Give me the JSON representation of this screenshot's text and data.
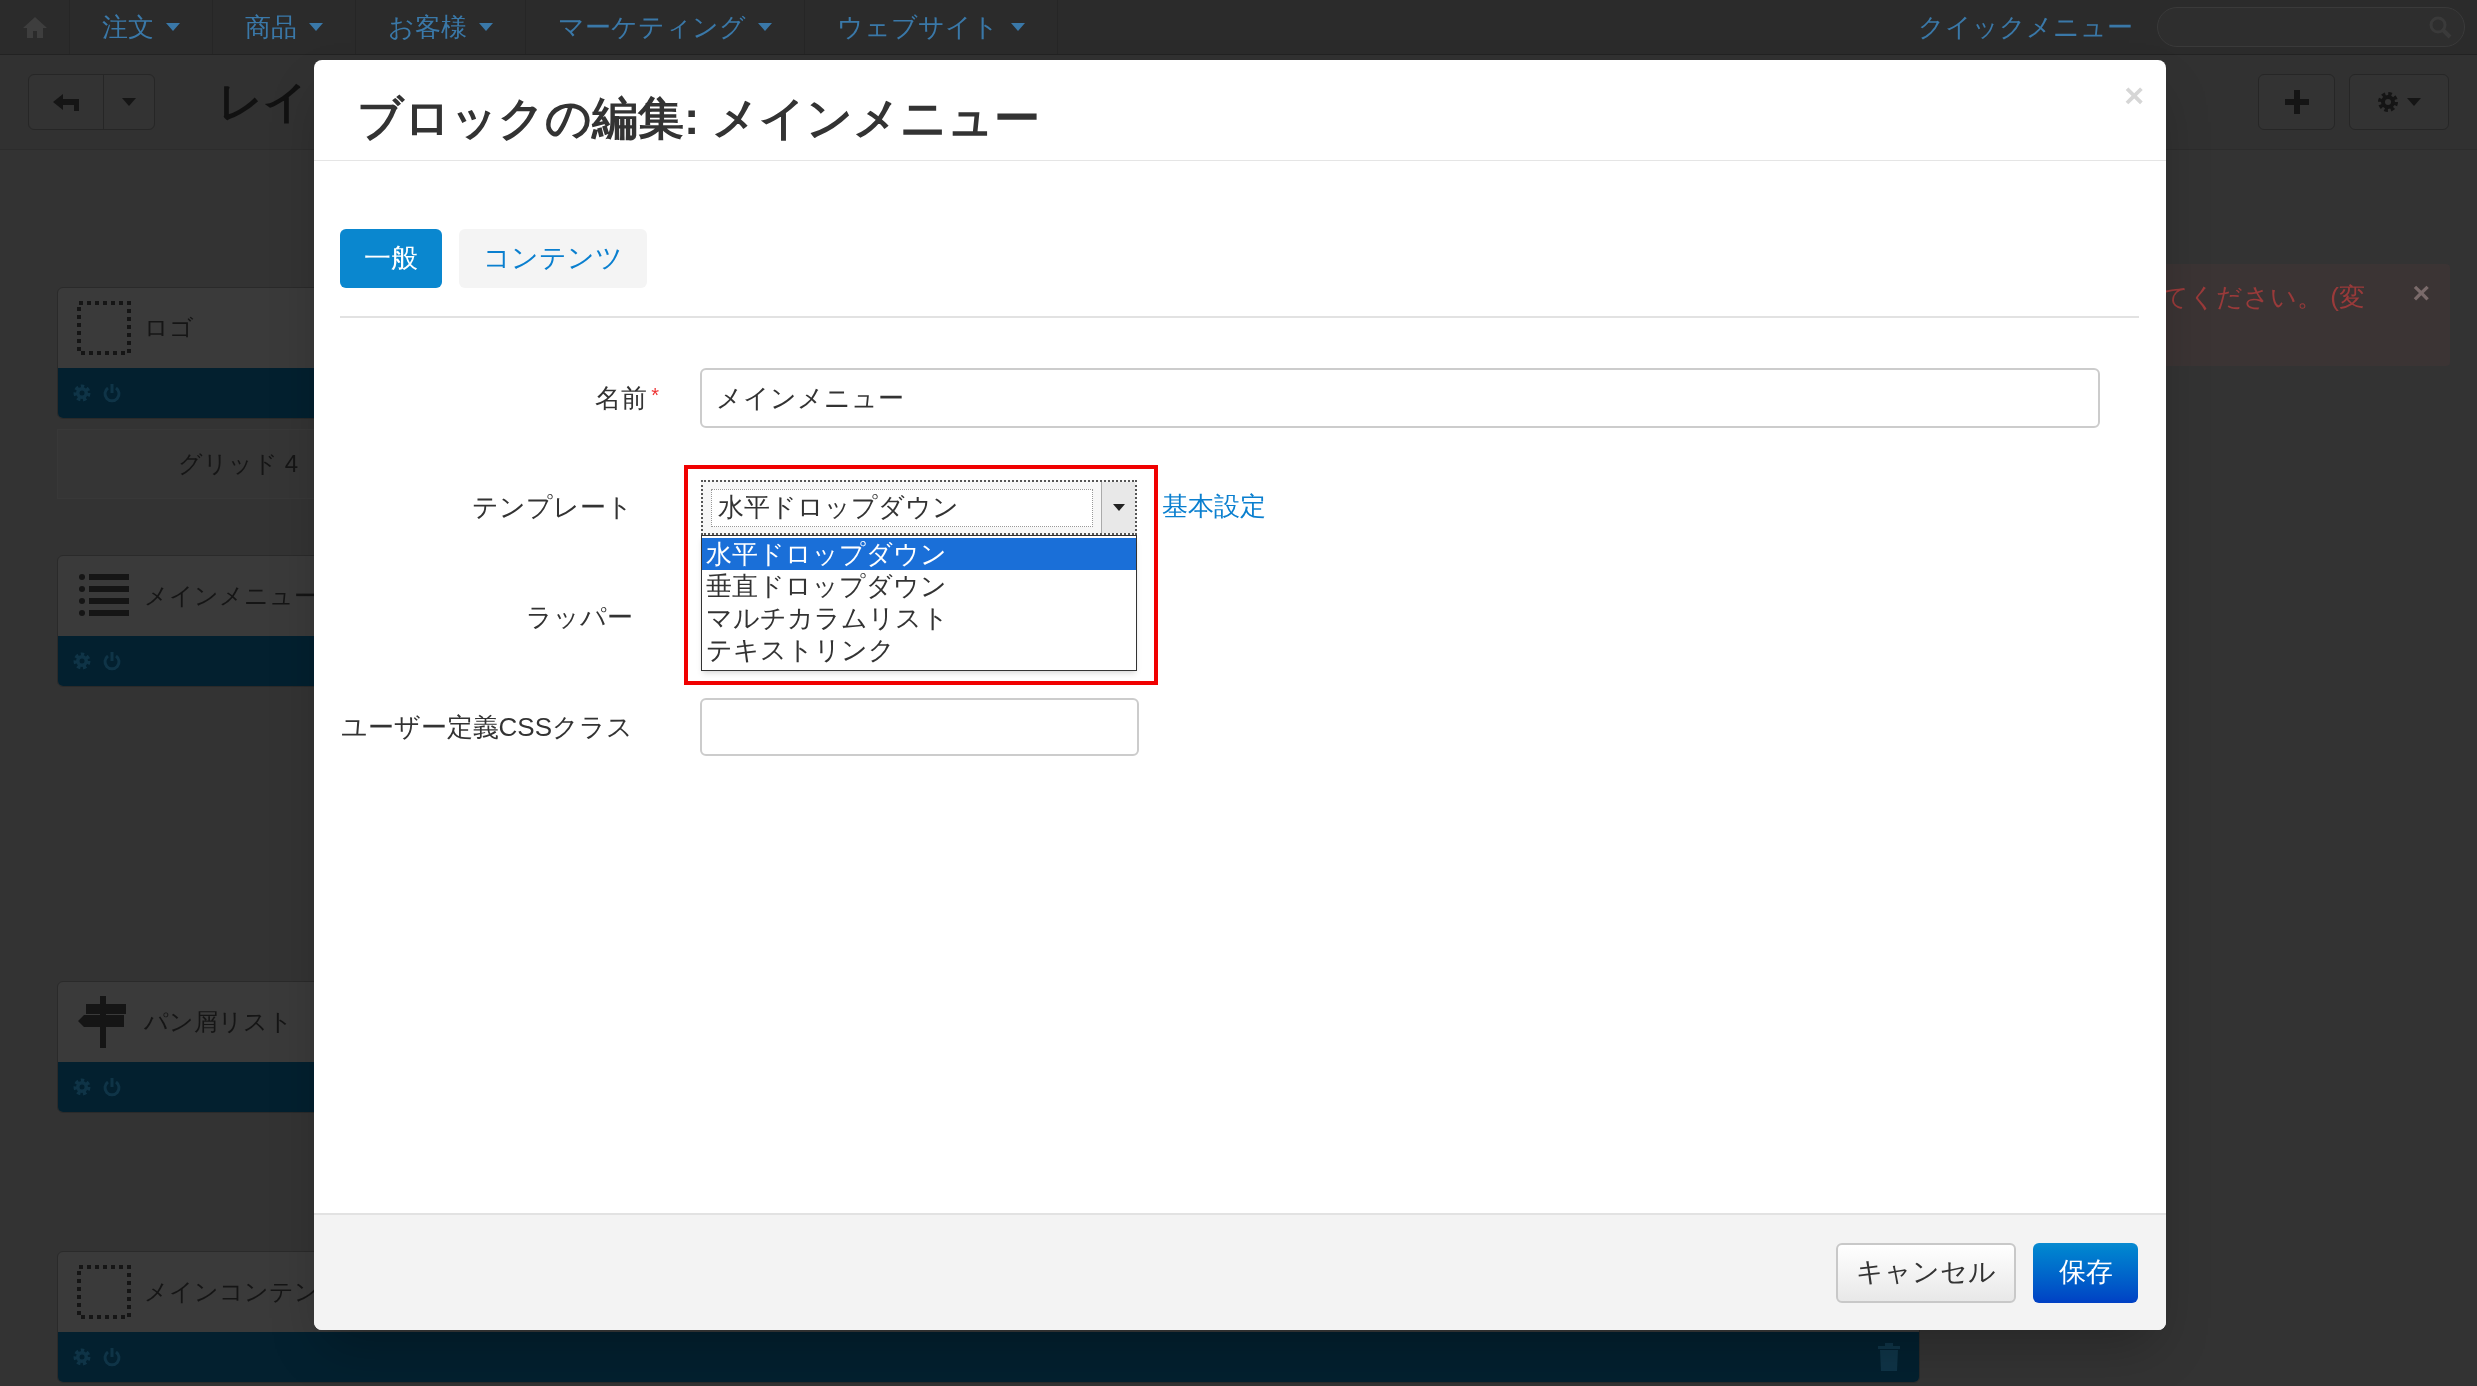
{
  "nav": {
    "items": [
      {
        "label": "注文"
      },
      {
        "label": "商品"
      },
      {
        "label": "お客様"
      },
      {
        "label": "マーケティング"
      },
      {
        "label": "ウェブサイト"
      }
    ],
    "quick_menu": "クイックメニュー"
  },
  "page": {
    "title": "レイ",
    "alert": "てください。 (変",
    "alert_close": "×"
  },
  "blocks": [
    {
      "kind": "empty",
      "title": "ロゴ",
      "caption": "グリッド 4"
    },
    {
      "kind": "list",
      "title": "メインメニュー"
    },
    {
      "kind": "sign",
      "title": "パン屑リスト"
    },
    {
      "kind": "empty",
      "title": "メインコンテン",
      "wide": true
    }
  ],
  "modal": {
    "title": "ブロックの編集: メインメニュー",
    "close": "×",
    "tabs": [
      {
        "label": "一般",
        "selected": true
      },
      {
        "label": "コンテンツ",
        "selected": false
      }
    ],
    "name": {
      "label": "名前",
      "required": true,
      "required_mark": "*",
      "value": "メインメニュー"
    },
    "template": {
      "label": "テンプレート",
      "value": "水平ドロップダウン",
      "highlighted": true,
      "expanded": true,
      "link": "基本設定",
      "options": [
        {
          "label": "水平ドロップダウン",
          "selected": true
        },
        {
          "label": "垂直ドロップダウン",
          "selected": false
        },
        {
          "label": "マルチカラムリスト",
          "selected": false
        },
        {
          "label": "テキストリンク",
          "selected": false
        }
      ]
    },
    "wrapper": {
      "label": "ラッパー"
    },
    "css_class": {
      "label": "ユーザー定義CSSクラス"
    },
    "buttons": [
      {
        "kind": "cancel",
        "label": "キャンセル"
      },
      {
        "kind": "save",
        "label": "保存"
      }
    ]
  }
}
